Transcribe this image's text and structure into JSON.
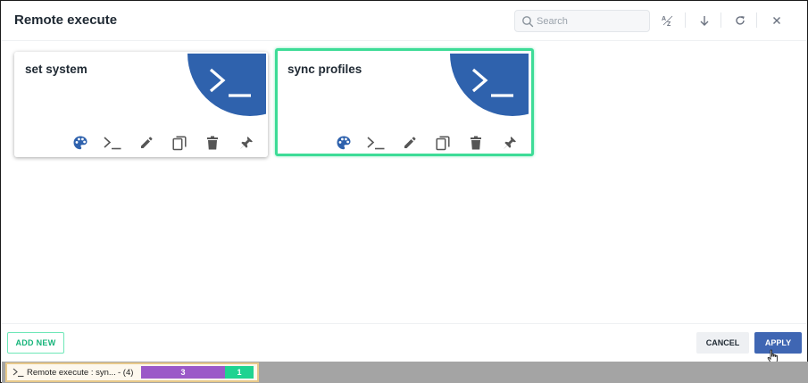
{
  "dialog": {
    "title": "Remote execute"
  },
  "search": {
    "placeholder": "Search",
    "value": ""
  },
  "header_icons": [
    "sort-az-icon",
    "arrow-down-icon",
    "refresh-icon",
    "close-icon"
  ],
  "cards": [
    {
      "name": "set system",
      "selected": false,
      "icon": "terminal-icon",
      "actions": [
        "palette-icon",
        "terminal-icon",
        "edit-icon",
        "copy-icon",
        "delete-icon",
        "pin-icon"
      ]
    },
    {
      "name": "sync profiles",
      "selected": true,
      "icon": "terminal-icon",
      "actions": [
        "palette-icon",
        "terminal-icon",
        "edit-icon",
        "copy-icon",
        "delete-icon",
        "pin-icon"
      ]
    }
  ],
  "footer": {
    "add_label": "ADD NEW",
    "cancel_label": "CANCEL",
    "apply_label": "APPLY"
  },
  "taskbar": {
    "task_label": "Remote execute : syn...",
    "task_count": "- (4)",
    "progress": [
      {
        "label": "3",
        "color": "#9b59c8"
      },
      {
        "label": "1",
        "color": "#1fd391"
      }
    ]
  },
  "colors": {
    "accent": "#3f66b3",
    "card_blob": "#2f62ad",
    "selected_border": "#3ddc97",
    "add_text": "#16b47a"
  }
}
